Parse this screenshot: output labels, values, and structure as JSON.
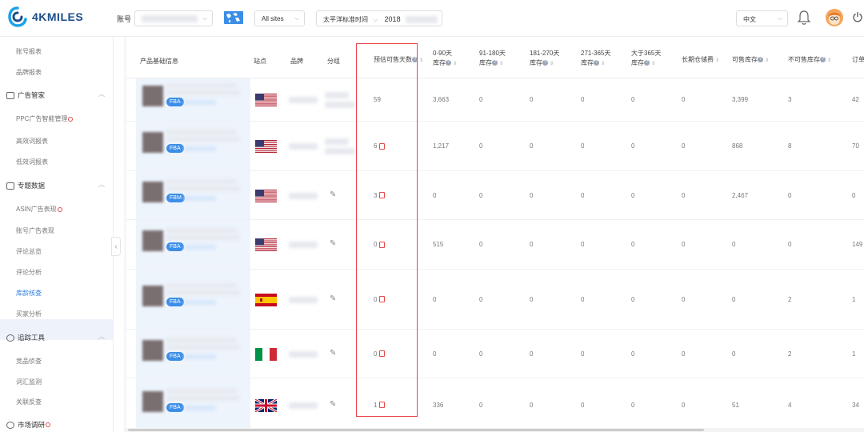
{
  "header": {
    "brand": "4KMILES",
    "account_label": "账号",
    "sites_select": "All sites",
    "timezone_label": "太平洋标准时间",
    "date_prefix": "2018",
    "language": "中文"
  },
  "sidebar": {
    "top_items": [
      "账号报表",
      "品牌报表"
    ],
    "groups": [
      {
        "title": "广告管家",
        "items": [
          "PPC广告智能管理",
          "高效词报表",
          "低效词报表"
        ]
      },
      {
        "title": "专题数据",
        "items": [
          "ASIN广告表现",
          "账号广告表现",
          "评论总览",
          "评论分析",
          "库龄核查",
          "买家分析"
        ]
      },
      {
        "title": "追踪工具",
        "items": [
          "竞品侦查",
          "词汇监测",
          "关联反查"
        ]
      },
      {
        "title": "市场调研",
        "items": []
      }
    ],
    "active_item": "库龄核查"
  },
  "table": {
    "headers": {
      "product": "产品基础信息",
      "site": "站点",
      "brand": "品牌",
      "group": "分组",
      "est_days": "预估可售天数",
      "age_0_90_a": "0-90天",
      "age_0_90_b": "库存",
      "age_91_180_a": "91-180天",
      "age_91_180_b": "库存",
      "age_181_270_a": "181-270天",
      "age_181_270_b": "库存",
      "age_271_365_a": "271-365天",
      "age_271_365_b": "库存",
      "age_365_plus_a": "大于365天",
      "age_365_plus_b": "库存",
      "long_term_fee": "长期仓储费",
      "sellable": "可售库存",
      "unsellable": "不可售库存",
      "order": "订单"
    },
    "rows": [
      {
        "tag": "FBA",
        "flag": "us",
        "est_days": "59",
        "d0": "3,663",
        "d91": "0",
        "d181": "0",
        "d271": "0",
        "d365": "0",
        "fee": "0",
        "sellable": "3,399",
        "unsellable": "3",
        "order": "42"
      },
      {
        "tag": "FBA",
        "flag": "us",
        "est_days": "6",
        "d0": "1,217",
        "d91": "0",
        "d181": "0",
        "d271": "0",
        "d365": "0",
        "fee": "0",
        "sellable": "868",
        "unsellable": "8",
        "order": "70"
      },
      {
        "tag": "FBM",
        "flag": "us",
        "est_days": "3",
        "d0": "0",
        "d91": "0",
        "d181": "0",
        "d271": "0",
        "d365": "0",
        "fee": "0",
        "sellable": "2,467",
        "unsellable": "0",
        "order": "0"
      },
      {
        "tag": "FBA",
        "flag": "us",
        "est_days": "0",
        "d0": "515",
        "d91": "0",
        "d181": "0",
        "d271": "0",
        "d365": "0",
        "fee": "0",
        "sellable": "0",
        "unsellable": "0",
        "order": "149"
      },
      {
        "tag": "FBA",
        "flag": "es",
        "est_days": "0",
        "d0": "0",
        "d91": "0",
        "d181": "0",
        "d271": "0",
        "d365": "0",
        "fee": "0",
        "sellable": "0",
        "unsellable": "2",
        "order": "1"
      },
      {
        "tag": "FBA",
        "flag": "it",
        "est_days": "0",
        "d0": "0",
        "d91": "0",
        "d181": "0",
        "d271": "0",
        "d365": "0",
        "fee": "0",
        "sellable": "0",
        "unsellable": "2",
        "order": "1"
      },
      {
        "tag": "FBA",
        "flag": "gb",
        "est_days": "1",
        "d0": "336",
        "d91": "0",
        "d181": "0",
        "d271": "0",
        "d365": "0",
        "fee": "0",
        "sellable": "51",
        "unsellable": "4",
        "order": "34"
      }
    ]
  },
  "colors": {
    "accent": "#3d8ee8",
    "highlight_border": "#e8454a",
    "logo": "#1d4e89"
  }
}
